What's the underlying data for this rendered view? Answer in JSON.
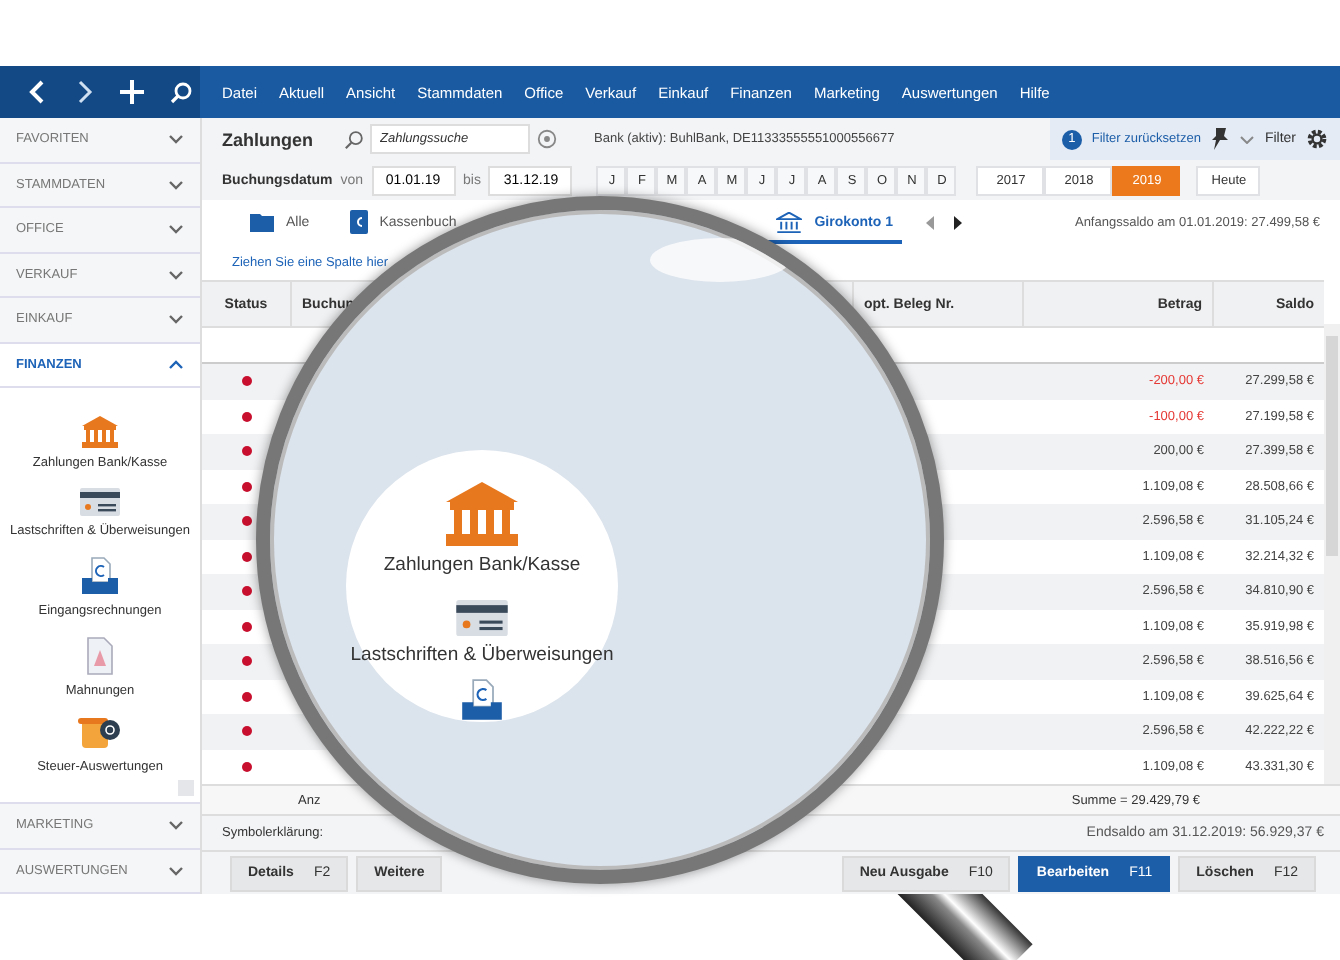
{
  "menu": [
    "Datei",
    "Aktuell",
    "Ansicht",
    "Stammdaten",
    "Office",
    "Verkauf",
    "Einkauf",
    "Finanzen",
    "Marketing",
    "Auswertungen",
    "Hilfe"
  ],
  "sidebar": {
    "sections_top": [
      {
        "label": "FAVORITEN",
        "expanded": false
      },
      {
        "label": "STAMMDATEN",
        "expanded": false
      },
      {
        "label": "OFFICE",
        "expanded": false
      },
      {
        "label": "VERKAUF",
        "expanded": false
      },
      {
        "label": "EINKAUF",
        "expanded": false
      },
      {
        "label": "FINANZEN",
        "expanded": true
      }
    ],
    "items": [
      {
        "label": "Zahlungen Bank/Kasse",
        "kind": "bank"
      },
      {
        "label": "Lastschriften & Überweisungen",
        "kind": "card"
      },
      {
        "label": "Eingangsrechnungen",
        "kind": "invoice"
      },
      {
        "label": "Mahnungen",
        "kind": "reminder"
      },
      {
        "label": "Steuer-Auswertungen",
        "kind": "tax"
      }
    ],
    "sections_bottom": [
      {
        "label": "MARKETING",
        "expanded": false
      },
      {
        "label": "AUSWERTUNGEN",
        "expanded": false
      }
    ]
  },
  "toolbar": {
    "title": "Zahlungen",
    "search": {
      "placeholder": "Zahlungssuche"
    },
    "bank": "Bank (aktiv): BuhlBank, DE11333555551000556677",
    "filter_count": "1",
    "filter_reset": "Filter zurücksetzen",
    "filter": "Filter"
  },
  "date_range": {
    "label": "Buchungsdatum",
    "from_label": "von",
    "from": "01.01.19",
    "to_label": "bis",
    "to": "31.12.19"
  },
  "months": [
    {
      "label": "J",
      "selected": false
    },
    {
      "label": "F",
      "selected": false
    },
    {
      "label": "M",
      "selected": false
    },
    {
      "label": "A",
      "selected": false
    },
    {
      "label": "M",
      "selected": false
    },
    {
      "label": "J",
      "selected": false
    },
    {
      "label": "J",
      "selected": false
    },
    {
      "label": "A",
      "selected": false
    },
    {
      "label": "S",
      "selected": false
    },
    {
      "label": "O",
      "selected": false
    },
    {
      "label": "N",
      "selected": false
    },
    {
      "label": "D",
      "selected": false
    }
  ],
  "years": [
    {
      "label": "2017",
      "selected": false
    },
    {
      "label": "2018",
      "selected": false
    },
    {
      "label": "2019",
      "selected": true
    }
  ],
  "today": "Heute",
  "tabs": [
    {
      "label": "Alle",
      "kind": "folder",
      "selected": false
    },
    {
      "label": "Kassenbuch",
      "kind": "cash",
      "selected": false
    },
    {
      "label": "Girokonto 1",
      "kind": "bank",
      "selected": true
    }
  ],
  "opening_balance": "Anfangssaldo am 01.01.2019: 27.499,58 €",
  "group_hint": "Ziehen Sie eine Spalte hier",
  "table": {
    "columns": [
      "Status",
      "Buchun",
      "opt. Beleg Nr.",
      "Betrag",
      "Saldo"
    ],
    "rows": [
      {
        "amount": "-200,00 €",
        "negative": true,
        "balance": "27.299,58 €"
      },
      {
        "amount": "-100,00 €",
        "negative": true,
        "balance": "27.199,58 €"
      },
      {
        "amount": "200,00 €",
        "negative": false,
        "balance": "27.399,58 €"
      },
      {
        "amount": "1.109,08 €",
        "negative": false,
        "balance": "28.508,66 €"
      },
      {
        "amount": "2.596,58 €",
        "negative": false,
        "balance": "31.105,24 €"
      },
      {
        "amount": "1.109,08 €",
        "negative": false,
        "balance": "32.214,32 €"
      },
      {
        "amount": "2.596,58 €",
        "negative": false,
        "balance": "34.810,90 €"
      },
      {
        "amount": "1.109,08 €",
        "negative": false,
        "balance": "35.919,98 €"
      },
      {
        "amount": "2.596,58 €",
        "negative": false,
        "balance": "38.516,56 €"
      },
      {
        "amount": "1.109,08 €",
        "negative": false,
        "balance": "39.625,64 €"
      },
      {
        "amount": "2.596,58 €",
        "negative": false,
        "balance": "42.222,22 €"
      },
      {
        "amount": "1.109,08 €",
        "negative": false,
        "balance": "43.331,30 €"
      }
    ],
    "count_label": "Anz",
    "sum": "Summe = 29.429,79 €"
  },
  "legend": "Symbolerklärung:",
  "closing_balance": "Endsaldo am 31.12.2019: 56.929,37 €",
  "buttons_left": [
    {
      "label": "Details",
      "key": "F2"
    },
    {
      "label": "Weitere"
    }
  ],
  "buttons_right": [
    {
      "label": "Neu Ausgabe",
      "key": "F10",
      "primary": false
    },
    {
      "label": "Bearbeiten",
      "key": "F11",
      "primary": true
    },
    {
      "label": "Löschen",
      "key": "F12",
      "primary": false
    }
  ],
  "magnifier": {
    "items": [
      {
        "label": "Zahlungen Bank/Kasse",
        "kind": "bank"
      },
      {
        "label": "Lastschriften & Überweisungen",
        "kind": "card"
      }
    ]
  }
}
